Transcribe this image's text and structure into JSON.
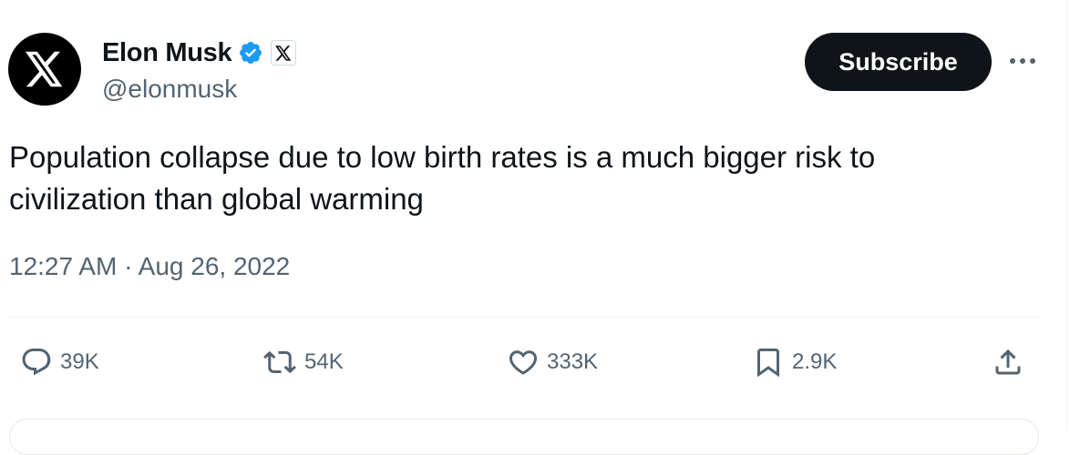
{
  "author": {
    "display_name": "Elon Musk",
    "handle": "@elonmusk",
    "avatar_icon": "x-logo-icon",
    "verified_icon": "verified-badge-icon",
    "affiliate_icon": "x-affiliate-badge-icon"
  },
  "header": {
    "subscribe_label": "Subscribe",
    "more_icon": "more-dots-icon"
  },
  "tweet": {
    "text": "Population collapse due to low birth rates is a much bigger risk to\ncivilization than global warming",
    "timestamp": "12:27 AM · Aug 26, 2022"
  },
  "actions": {
    "reply": {
      "icon": "reply-icon",
      "count": "39K"
    },
    "repost": {
      "icon": "repost-icon",
      "count": "54K"
    },
    "like": {
      "icon": "heart-icon",
      "count": "333K"
    },
    "bookmark": {
      "icon": "bookmark-icon",
      "count": "2.9K"
    },
    "share": {
      "icon": "share-icon"
    }
  },
  "colors": {
    "text_primary": "#0f1419",
    "text_secondary": "#536471",
    "verified_blue": "#1d9bf0",
    "divider": "#eff3f4"
  }
}
